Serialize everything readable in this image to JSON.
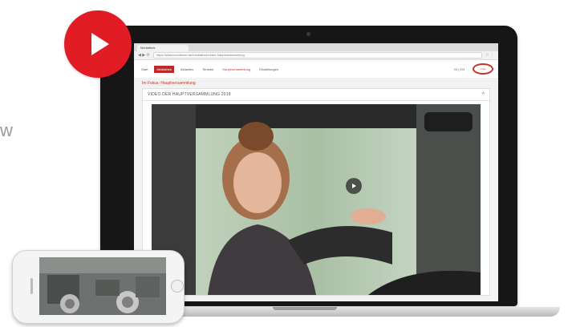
{
  "side_text": "w",
  "browser": {
    "tab_label": "Mediathek",
    "url": "https://www.vorsteiner.de/mediathek/video-hauptversammlung",
    "nav_glyphs": "◀ ▶ ⟳",
    "toolbar_glyphs": "☆ ⋮"
  },
  "site": {
    "nav": [
      {
        "label": "Start"
      },
      {
        "label": "Mediathek"
      },
      {
        "label": "Aktuelles"
      },
      {
        "label": "Termine"
      },
      {
        "label": "Hauptversammlung"
      },
      {
        "label": "Einstellungen"
      }
    ],
    "user": "IN | EN",
    "logo_text": "Logo"
  },
  "content": {
    "heading": "Im Fokus: Hauptversammlung",
    "panel_title": "VIDEO DER HAUPTVERSAMMLUNG 2018",
    "collapse_glyph": "^"
  },
  "icons": {
    "play_big": "play-icon",
    "play_small": "play-icon",
    "collapse": "chevron-up-icon"
  },
  "colors": {
    "play_red": "#e11c24",
    "accent_red": "#b92a2a"
  }
}
